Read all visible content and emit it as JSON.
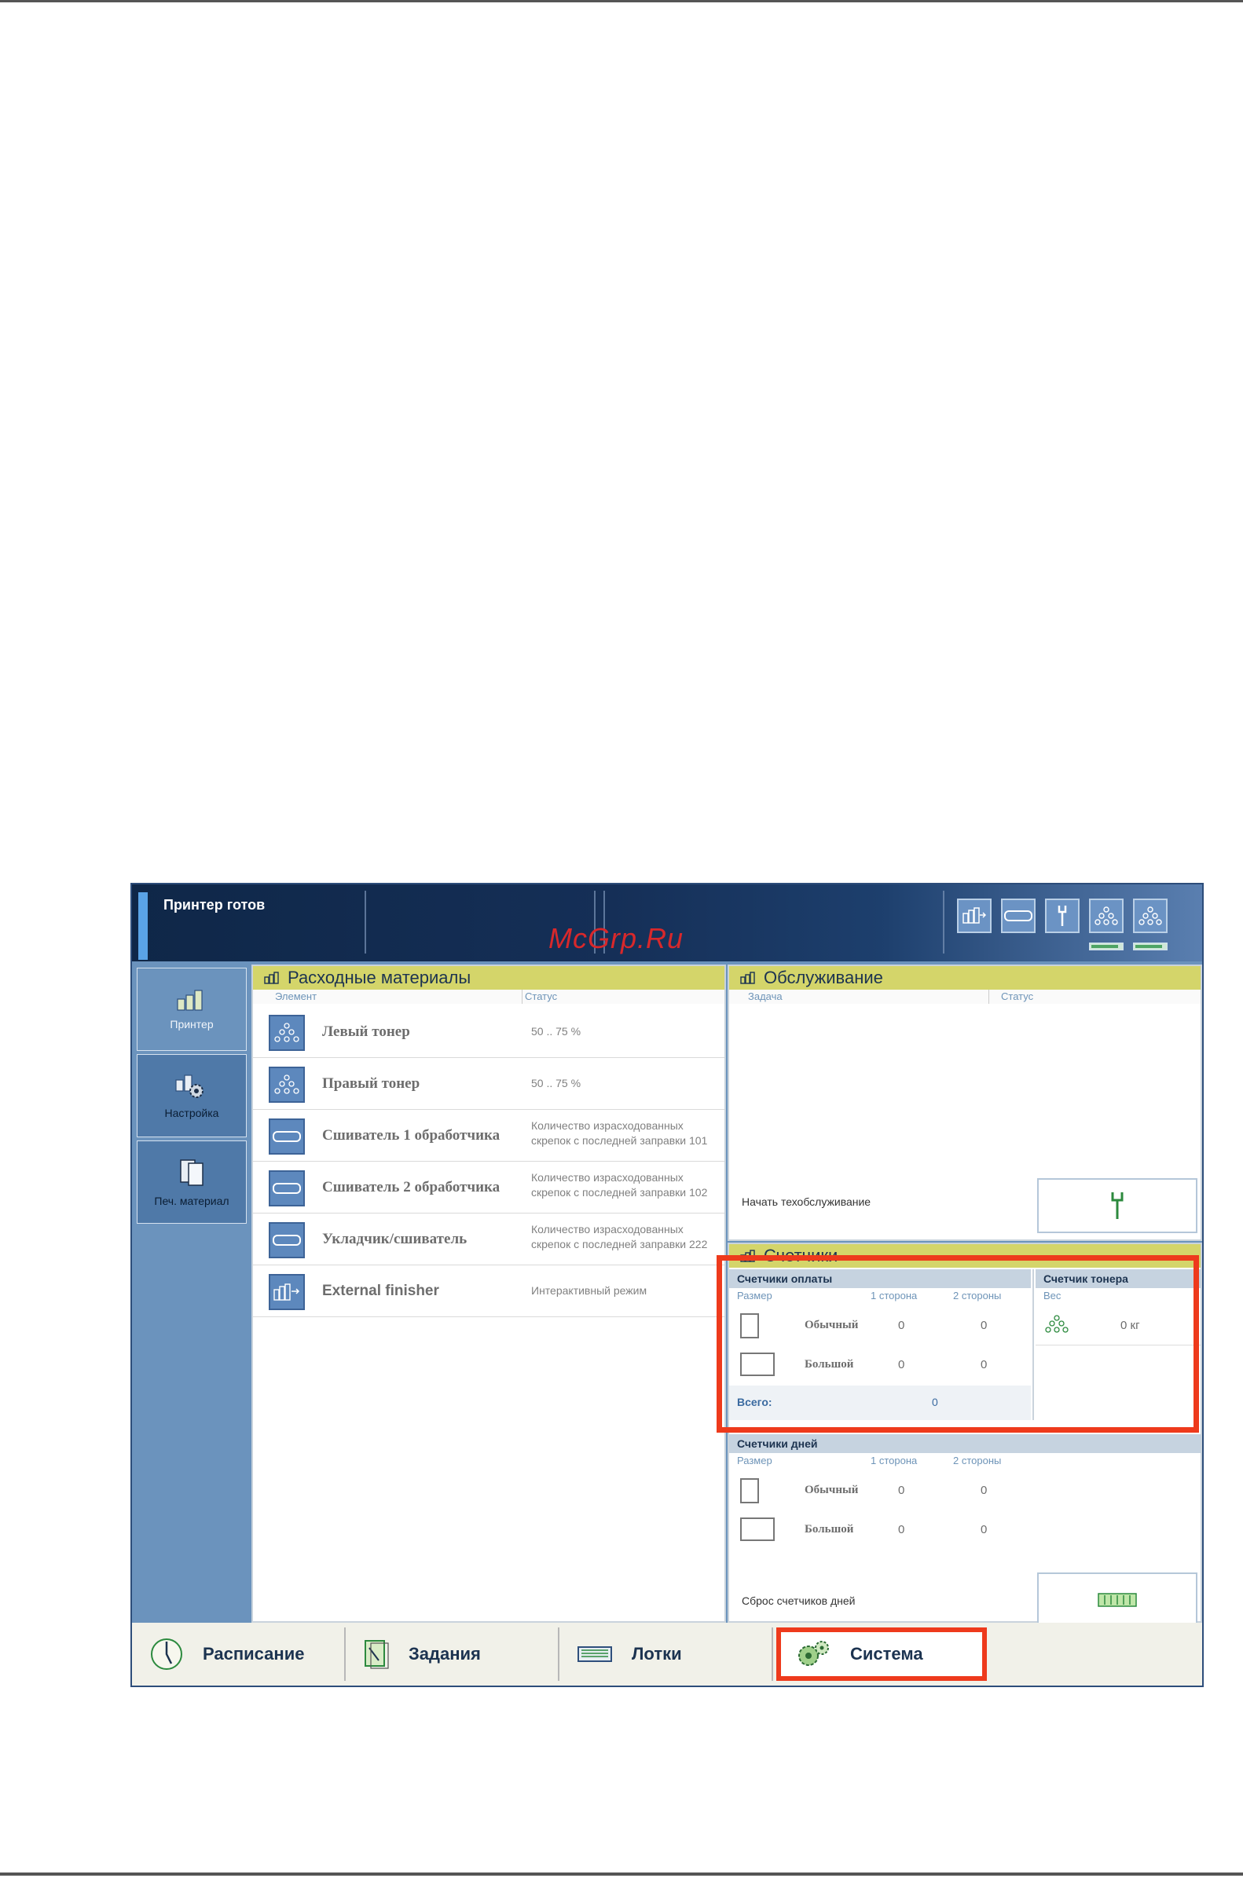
{
  "status_bar": {
    "text": "Принтер готов",
    "watermark": "McGrp.Ru",
    "icons": [
      "external-finisher-icon",
      "stapler-icon",
      "wrench-icon",
      "left-toner-icon",
      "right-toner-icon"
    ],
    "toner_levels": [
      0.8,
      0.8
    ]
  },
  "left_nav": {
    "items": [
      {
        "label": "Принтер",
        "icon": "printer-bars-icon",
        "active": true
      },
      {
        "label": "Настройка",
        "icon": "settings-gear-icon",
        "active": false
      },
      {
        "label": "Печ. материал",
        "icon": "media-sheets-icon",
        "active": false
      }
    ]
  },
  "consumables": {
    "title": "Расходные материалы",
    "col_element": "Элемент",
    "col_status": "Статус",
    "rows": [
      {
        "name": "Левый тонер",
        "status": "50 .. 75 %",
        "icon": "toner-icon"
      },
      {
        "name": "Правый тонер",
        "status": "50 .. 75 %",
        "icon": "toner-icon"
      },
      {
        "name": "Сшиватель 1 обработчика",
        "status": "Количество израсходованных скрепок с последней заправки 101",
        "icon": "stapler-icon"
      },
      {
        "name": "Сшиватель 2 обработчика",
        "status": "Количество израсходованных скрепок с последней заправки 102",
        "icon": "stapler-icon"
      },
      {
        "name": "Укладчик/сшиватель",
        "status": "Количество израсходованных скрепок с последней заправки 222",
        "icon": "stapler-icon"
      },
      {
        "name": "External finisher",
        "status": "Интерактивный режим",
        "icon": "external-finisher-icon"
      }
    ]
  },
  "maintenance": {
    "title": "Обслуживание",
    "col_task": "Задача",
    "col_status": "Статус",
    "start_label": "Начать техобслуживание"
  },
  "counters": {
    "title": "Счетчики",
    "billing": {
      "title": "Счетчики оплаты",
      "col_size": "Размер",
      "col_1side": "1 сторона",
      "col_2sides": "2 стороны",
      "rows": [
        {
          "size": "Обычный",
          "one": "0",
          "two": "0"
        },
        {
          "size": "Большой",
          "one": "0",
          "two": "0"
        }
      ],
      "total_label": "Всего:",
      "total_value": "0"
    },
    "toner": {
      "title": "Счетчик тонера",
      "col_weight": "Вес",
      "value": "0 кг"
    },
    "daily": {
      "title": "Счетчики дней",
      "col_size": "Размер",
      "col_1side": "1 сторона",
      "col_2sides": "2 стороны",
      "rows": [
        {
          "size": "Обычный",
          "one": "0",
          "two": "0"
        },
        {
          "size": "Большой",
          "one": "0",
          "two": "0"
        }
      ],
      "reset_label": "Сброс счетчиков дней"
    }
  },
  "bottom_tabs": [
    {
      "label": "Расписание",
      "icon": "clock-icon"
    },
    {
      "label": "Задания",
      "icon": "jobs-document-icon"
    },
    {
      "label": "Лотки",
      "icon": "trays-icon"
    },
    {
      "label": "Система",
      "icon": "system-gears-icon"
    }
  ],
  "colors": {
    "panel_title_bg": "#d4d56a",
    "nav_bg": "#6b93bd",
    "highlight": "#ee3a1c"
  }
}
